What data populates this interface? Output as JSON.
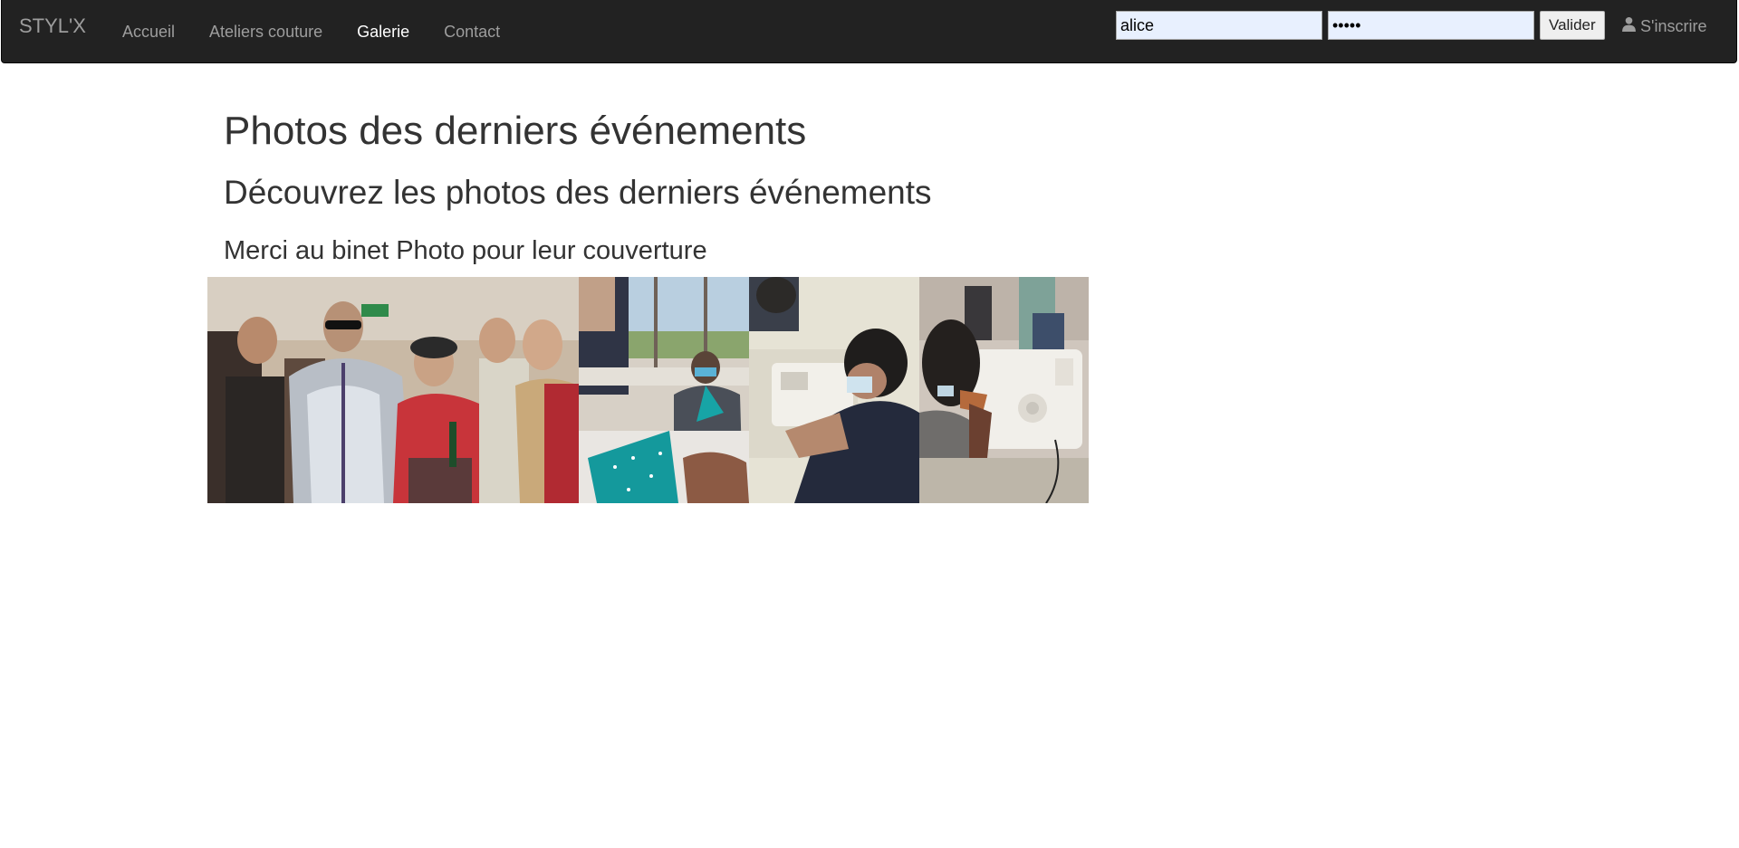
{
  "navbar": {
    "brand": "STYL'X",
    "links": [
      {
        "label": "Accueil",
        "active": false
      },
      {
        "label": "Ateliers couture",
        "active": false
      },
      {
        "label": "Galerie",
        "active": true
      },
      {
        "label": "Contact",
        "active": false
      }
    ],
    "login": {
      "username_value": "alice",
      "password_value": "•••••",
      "submit_label": "Valider"
    },
    "signup_label": "S'inscrire",
    "signup_icon": "user-icon"
  },
  "content": {
    "title": "Photos des derniers événements",
    "subtitle": "Découvrez les photos des derniers événements",
    "credit": "Merci au binet Photo pour leur couverture"
  },
  "gallery": {
    "photos": [
      {
        "subject": "group-event-photo"
      },
      {
        "subject": "sewing-workshop-fabric-photo"
      },
      {
        "subject": "sewing-machine-photo"
      },
      {
        "subject": "sewing-machine-closeup-photo"
      }
    ]
  },
  "colors": {
    "navbar_bg": "#222222",
    "nav_text": "#9d9d9d",
    "nav_active": "#ffffff",
    "input_bg": "#e8f0fe",
    "text": "#333333"
  }
}
